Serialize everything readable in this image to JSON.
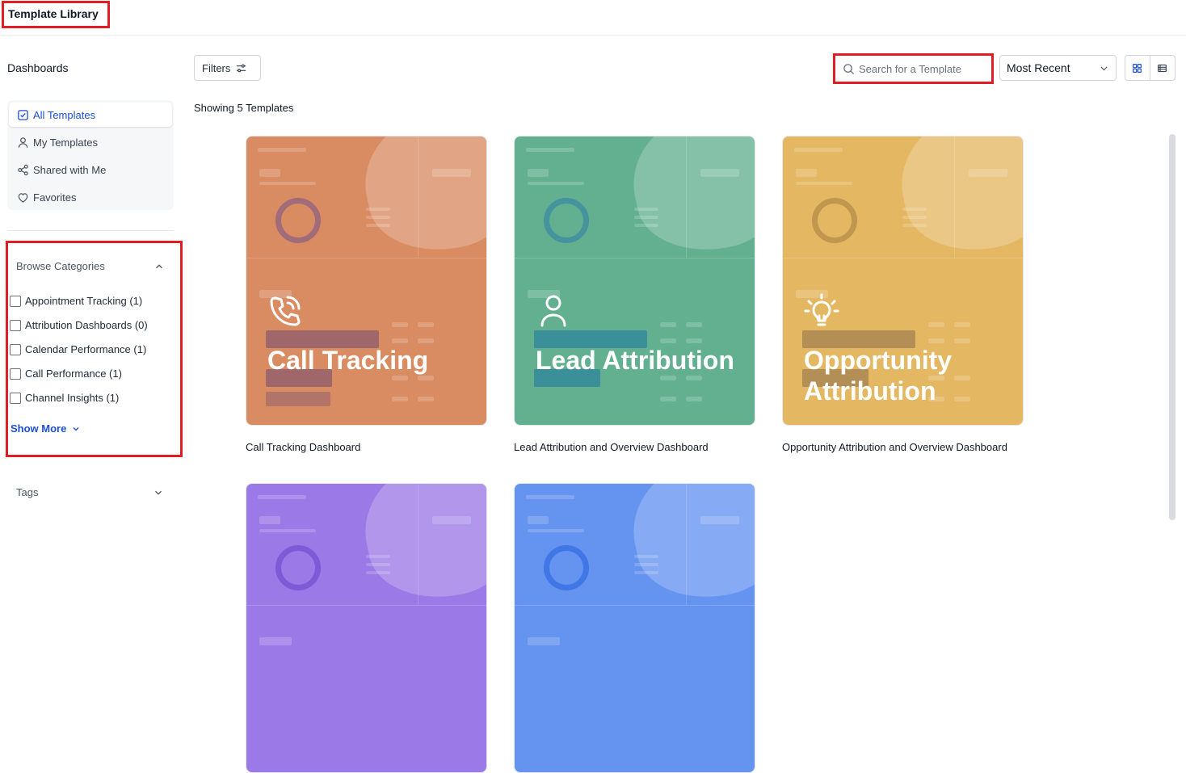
{
  "app": {
    "title": "Template Library"
  },
  "sidebar": {
    "heading": "Dashboards",
    "nav": [
      {
        "label": "All Templates",
        "icon": "check-square-icon",
        "active": true
      },
      {
        "label": "My Templates",
        "icon": "user-icon",
        "active": false
      },
      {
        "label": "Shared with Me",
        "icon": "share-icon",
        "active": false
      },
      {
        "label": "Favorites",
        "icon": "heart-icon",
        "active": false
      }
    ],
    "categories": {
      "heading": "Browse Categories",
      "items": [
        {
          "label": "Appointment Tracking (1)"
        },
        {
          "label": "Attribution Dashboards (0)"
        },
        {
          "label": "Calendar Performance (1)"
        },
        {
          "label": "Call Performance (1)"
        },
        {
          "label": "Channel Insights (1)"
        }
      ],
      "show_more": "Show More"
    },
    "tags": {
      "heading": "Tags"
    }
  },
  "toolbar": {
    "filters_label": "Filters",
    "search_placeholder": "Search for a Template",
    "sort_value": "Most Recent"
  },
  "main": {
    "showing": "Showing 5 Templates",
    "cards": [
      {
        "title": "Call Tracking",
        "caption": "Call Tracking Dashboard",
        "color": "#d98b62",
        "icon": "phone-ringing-icon"
      },
      {
        "title": "Lead Attribution",
        "caption": "Lead Attribution and Overview Dashboard",
        "color": "#62b090",
        "icon": "user-icon"
      },
      {
        "title": "Opportunity Attribution",
        "caption": "Opportunity Attribution and Overview Dashboard",
        "color": "#e4b862",
        "icon": "lightbulb-icon"
      },
      {
        "title": "",
        "caption": "",
        "color": "#9b79e6",
        "icon": ""
      },
      {
        "title": "",
        "caption": "",
        "color": "#6593f0",
        "icon": ""
      }
    ]
  }
}
